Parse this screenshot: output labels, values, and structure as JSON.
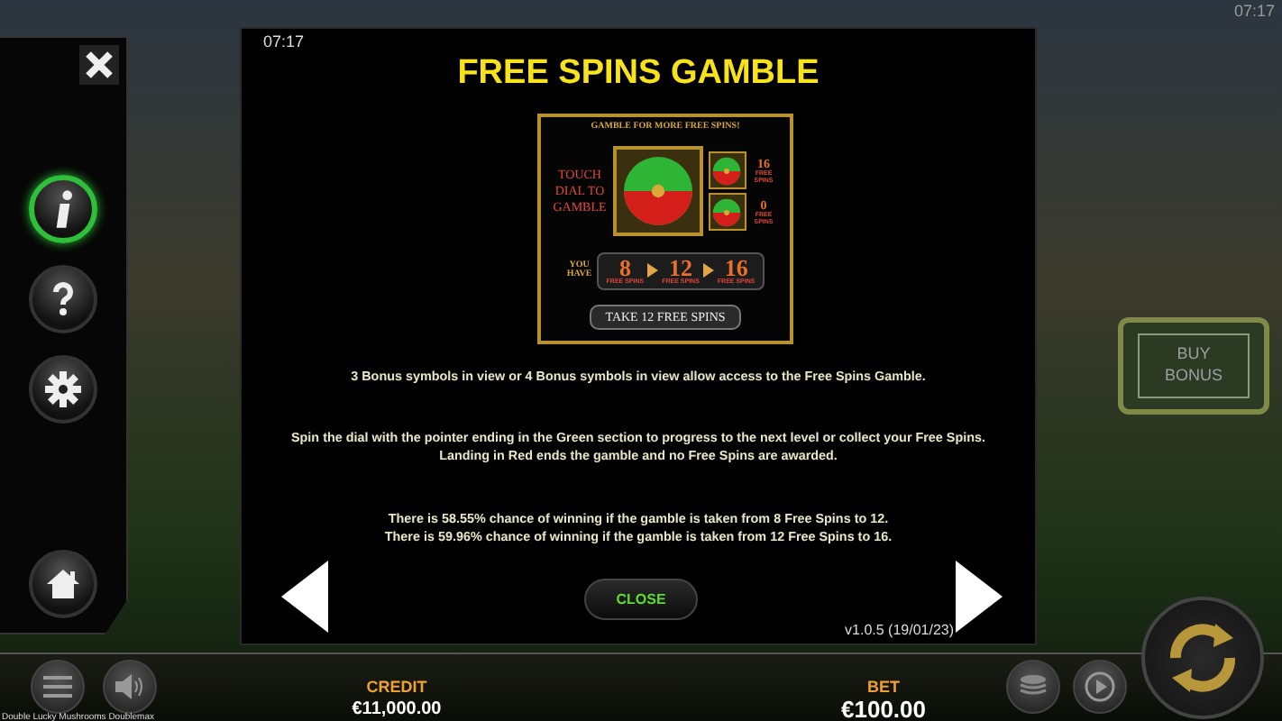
{
  "status_clock": "07:17",
  "side_menu": {
    "items": [
      {
        "kind": "info",
        "selected": true
      },
      {
        "kind": "help",
        "selected": false
      },
      {
        "kind": "settings",
        "selected": false
      },
      {
        "kind": "home",
        "selected": false
      }
    ]
  },
  "dialog": {
    "clock": "07:17",
    "title": "FREE SPINS GAMBLE",
    "figure": {
      "banner": "GAMBLE FOR MORE FREE SPINS!",
      "prompt": "TOUCH DIAL TO GAMBLE",
      "side_dials": [
        {
          "count": "16",
          "label": "FREE SPINS"
        },
        {
          "count": "0",
          "label": "FREE SPINS"
        }
      ],
      "you_have": "YOU HAVE",
      "steps": [
        {
          "count": "8",
          "label": "FREE SPINS"
        },
        {
          "count": "12",
          "label": "FREE SPINS"
        },
        {
          "count": "16",
          "label": "FREE SPINS"
        }
      ],
      "take_button": "TAKE 12 FREE SPINS"
    },
    "paragraphs": [
      "3 Bonus symbols in view or 4 Bonus symbols in view allow access to the Free Spins Gamble.",
      "Spin the dial with the pointer ending in the Green section to progress to the next level or collect your Free Spins. Landing in Red ends the gamble and no Free Spins are awarded.",
      "There is 58.55% chance of winning if the gamble is taken from 8 Free Spins to 12.\nThere is 59.96% chance of winning if the gamble is taken from 12 Free Spins to 16."
    ],
    "close_button": "CLOSE",
    "version": "v1.0.5 (19/01/23)"
  },
  "buy_bonus": "BUY BONUS",
  "bottom_bar": {
    "credit_label": "CREDIT",
    "credit_value": "€11,000.00",
    "bet_label": "BET",
    "bet_value": "€100.00",
    "game_name": "Double Lucky Mushrooms Doublemax"
  }
}
